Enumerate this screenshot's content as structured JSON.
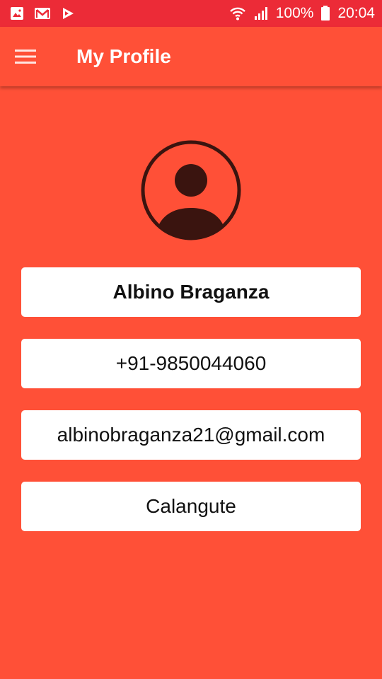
{
  "status_bar": {
    "battery_percent": "100%",
    "time": "20:04",
    "icons": [
      "image-icon",
      "gmail-icon",
      "play-store-icon",
      "wifi-icon",
      "signal-icon",
      "battery-icon"
    ]
  },
  "app_bar": {
    "title": "My Profile",
    "menu_icon": "hamburger-menu-icon"
  },
  "profile": {
    "avatar_icon": "person-avatar-icon",
    "name": "Albino Braganza",
    "phone": "+91-9850044060",
    "email": "albinobraganza21@gmail.com",
    "location": "Calangute"
  },
  "colors": {
    "status_bar": "#EC2B37",
    "primary": "#FF5037",
    "avatar_dark": "#3A140F",
    "card_bg": "#FFFFFF",
    "text": "#111111"
  }
}
